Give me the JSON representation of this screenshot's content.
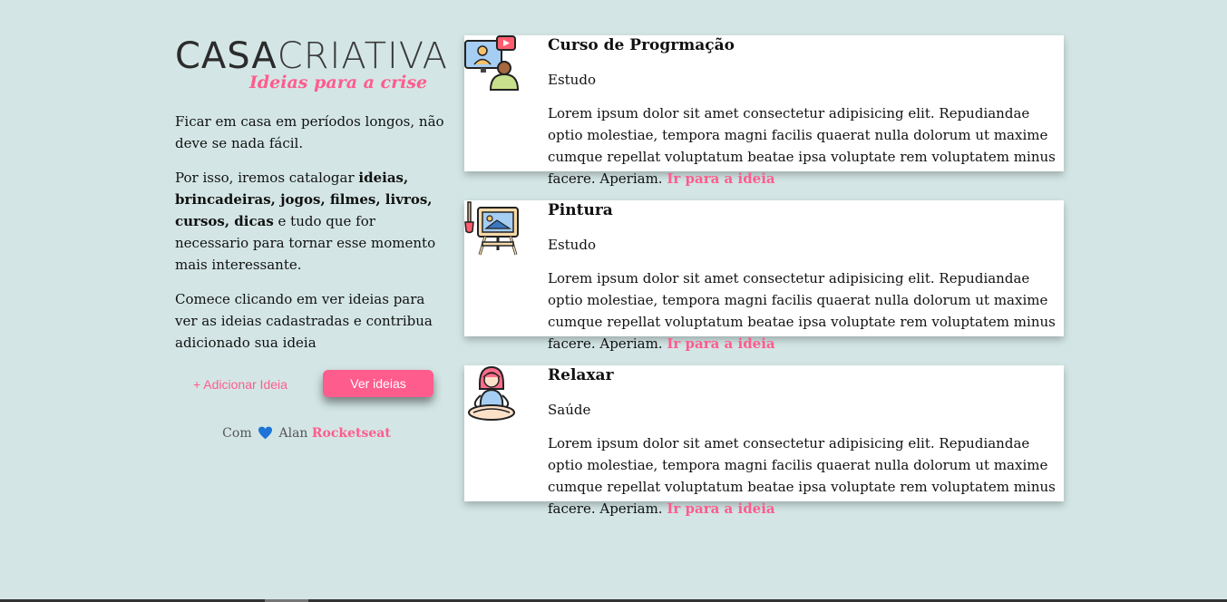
{
  "logo": {
    "part1": "CASA",
    "part2": "CRIATIVA",
    "tagline": "Ideias para a crise"
  },
  "intro": {
    "p1": "Ficar em casa em períodos longos, não deve se nada fácil.",
    "p2_before": "Por isso, iremos catalogar ",
    "p2_bold": "ideias, brincadeiras, jogos, filmes, livros, cursos, dicas",
    "p2_after": " e tudo que for necessario para tornar esse momento mais interessante.",
    "p3": "Comece clicando em ver ideias para ver as ideias cadastradas e contribua adicionado sua ideia"
  },
  "actions": {
    "add_label": "+ Adicionar Ideia",
    "see_label": "Ver ideias"
  },
  "credits": {
    "prefix": "Com",
    "name": "Alan",
    "brand": "Rocketseat"
  },
  "colors": {
    "background": "#d3e6e5",
    "accent": "#ff5c8e",
    "heart": "#1e74d6"
  },
  "cards": [
    {
      "icon": "video-course-icon",
      "title": "Curso de Progrmação",
      "category": "Estudo",
      "description": "Lorem ipsum dolor sit amet consectetur adipisicing elit. Repudiandae optio molestiae, tempora magni facilis quaerat nulla dolorum ut maxime cumque repellat voluptatum beatae ipsa voluptate rem voluptatem minus facere. Aperiam.",
      "link": "Ir para a ideia"
    },
    {
      "icon": "easel-painting-icon",
      "title": "Pintura",
      "category": "Estudo",
      "description": "Lorem ipsum dolor sit amet consectetur adipisicing elit. Repudiandae optio molestiae, tempora magni facilis quaerat nulla dolorum ut maxime cumque repellat voluptatum beatae ipsa voluptate rem voluptatem minus facere. Aperiam.",
      "link": "Ir para a ideia"
    },
    {
      "icon": "meditation-icon",
      "title": "Relaxar",
      "category": "Saúde",
      "description": "Lorem ipsum dolor sit amet consectetur adipisicing elit. Repudiandae optio molestiae, tempora magni facilis quaerat nulla dolorum ut maxime cumque repellat voluptatum beatae ipsa voluptate rem voluptatem minus facere. Aperiam.",
      "link": "Ir para a ideia"
    }
  ]
}
